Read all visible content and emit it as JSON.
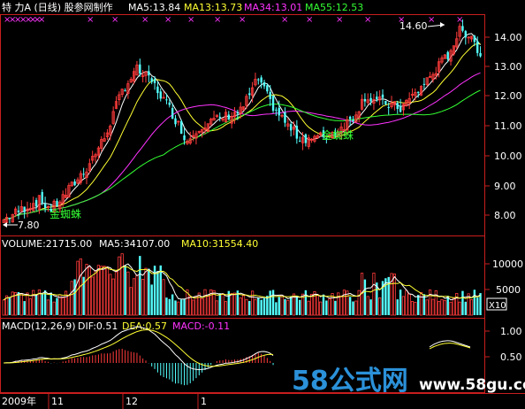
{
  "header": {
    "title": "特 力A (日线) 股参网制作",
    "ma_items": [
      {
        "text": "MA5:13.84",
        "color": "#ffffff"
      },
      {
        "text": "MA13:13.73",
        "color": "#ffff33"
      },
      {
        "text": "MA34:13.01",
        "color": "#ff33ff"
      },
      {
        "text": "MA55:12.53",
        "color": "#33ff33"
      }
    ]
  },
  "price_panel": {
    "y_ticks": [
      "14.00",
      "13.00",
      "12.00",
      "11.00",
      "10.00",
      "9.00",
      "8.00"
    ],
    "high_label": "14.60",
    "low_label": "7.80",
    "annotations": [
      "金蜘蛛",
      "金蜘蛛"
    ],
    "marker_glyph": "×"
  },
  "volume_panel": {
    "items": [
      {
        "text": "VOLUME:21715.00",
        "color": "#ffffff"
      },
      {
        "text": "MA5:34107.00",
        "color": "#ffffff"
      },
      {
        "text": "MA10:31554.40",
        "color": "#ffff33"
      }
    ],
    "y_ticks": [
      "10000",
      "5000"
    ],
    "unit": "X10"
  },
  "macd_panel": {
    "items": [
      {
        "text": "MACD(12,26,9)",
        "color": "#ffffff"
      },
      {
        "text": "DIF:0.51",
        "color": "#ffffff"
      },
      {
        "text": "DEA:0.57",
        "color": "#ffff33"
      },
      {
        "text": "MACD:-0.11",
        "color": "#ff33ff"
      }
    ],
    "y_ticks": [
      "1.00",
      "0.50"
    ]
  },
  "x_axis": {
    "labels": [
      "2009年",
      "11",
      "12",
      "1"
    ]
  },
  "watermark": {
    "text": "58公式网",
    "url": "www.58gu.com"
  },
  "colors": {
    "up": "#ff3b3b",
    "down": "#54ffff",
    "frame": "#c81e1e",
    "ma5": "#ffffff",
    "ma13": "#ffff33",
    "ma34": "#ff33ff",
    "ma55": "#33ff33",
    "annotation": "#33ff33",
    "marker": "#ff33ff"
  }
}
